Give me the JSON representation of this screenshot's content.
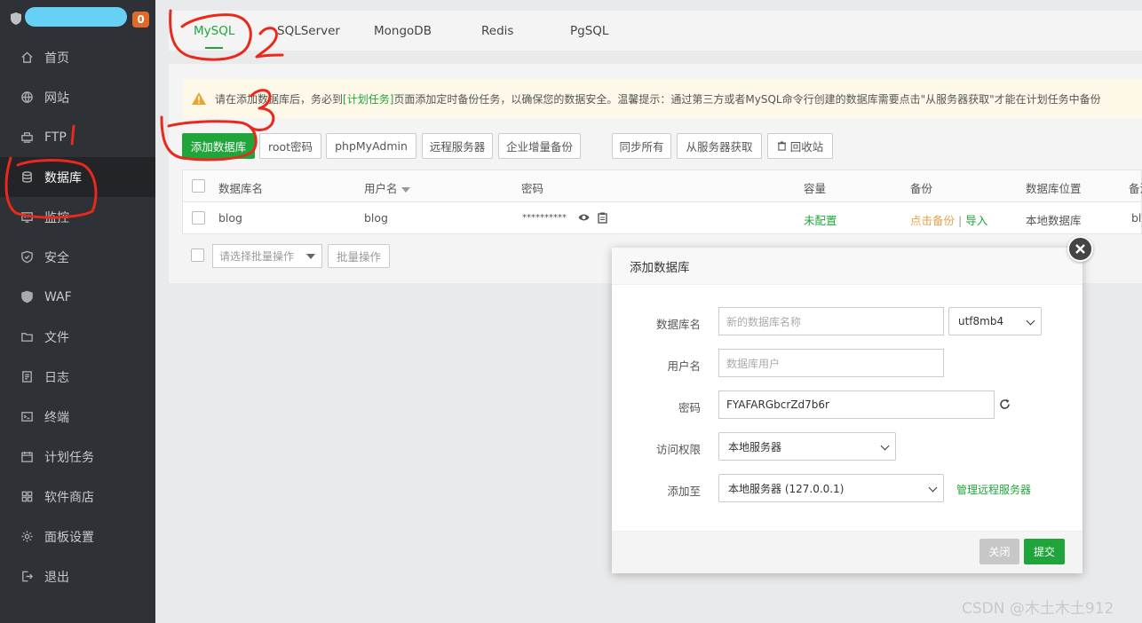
{
  "sidebar": {
    "badge": "0",
    "items": [
      {
        "label": "首页",
        "icon": "home-icon"
      },
      {
        "label": "网站",
        "icon": "globe-icon"
      },
      {
        "label": "FTP",
        "icon": "ftp-icon"
      },
      {
        "label": "数据库",
        "icon": "database-icon"
      },
      {
        "label": "监控",
        "icon": "monitor-icon"
      },
      {
        "label": "安全",
        "icon": "shield-check-icon"
      },
      {
        "label": "WAF",
        "icon": "waf-shield-icon"
      },
      {
        "label": "文件",
        "icon": "folder-icon"
      },
      {
        "label": "日志",
        "icon": "log-icon"
      },
      {
        "label": "终端",
        "icon": "terminal-icon"
      },
      {
        "label": "计划任务",
        "icon": "calendar-icon"
      },
      {
        "label": "软件商店",
        "icon": "apps-icon"
      },
      {
        "label": "面板设置",
        "icon": "gear-icon"
      },
      {
        "label": "退出",
        "icon": "logout-icon"
      }
    ]
  },
  "tabs": [
    "MySQL",
    "SQLServer",
    "MongoDB",
    "Redis",
    "PgSQL"
  ],
  "alert": {
    "prefix": "请在添加数据库后，务必到",
    "link": "[计划任务]",
    "suffix": "页面添加定时备份任务，以确保您的数据安全。温馨提示：通过第三方或者MySQL命令行创建的数据库需要点击\"从服务器获取\"才能在计划任务中备份"
  },
  "toolbar": {
    "add_db": "添加数据库",
    "root_pwd": "root密码",
    "phpmyadmin": "phpMyAdmin",
    "remote_server": "远程服务器",
    "enterprise_backup": "企业增量备份",
    "sync_all": "同步所有",
    "fetch_from_server": "从服务器获取",
    "recycle_bin": "回收站"
  },
  "table": {
    "headers": [
      "数据库名",
      "用户名",
      "密码",
      "容量",
      "备份",
      "数据库位置",
      "备注"
    ],
    "rows": [
      {
        "db": "blog",
        "user": "blog",
        "password": "**********",
        "capacity": "未配置",
        "backup_action": "点击备份",
        "separator": "|",
        "import": "导入",
        "location": "本地数据库",
        "note": "bl"
      }
    ]
  },
  "bulk": {
    "placeholder": "请选择批量操作",
    "button": "批量操作"
  },
  "dialog": {
    "title": "添加数据库",
    "fields": {
      "db_name_label": "数据库名",
      "db_name_placeholder": "新的数据库名称",
      "charset": "utf8mb4",
      "user_label": "用户名",
      "user_placeholder": "数据库用户",
      "password_label": "密码",
      "password_value": "FYAFARGbcrZd7b6r",
      "access_label": "访问权限",
      "access_value": "本地服务器",
      "add_to_label": "添加至",
      "add_to_value": "本地服务器 (127.0.0.1)",
      "manage_remote": "管理远程服务器"
    },
    "close_btn": "关闭",
    "submit_btn": "提交"
  },
  "watermark": "CSDN @木土木土912",
  "colors": {
    "brand_green": "#20a53a",
    "sidebar_bg": "#2e3135",
    "badge_orange": "#e0692c",
    "annotation_red": "#e8291c"
  }
}
